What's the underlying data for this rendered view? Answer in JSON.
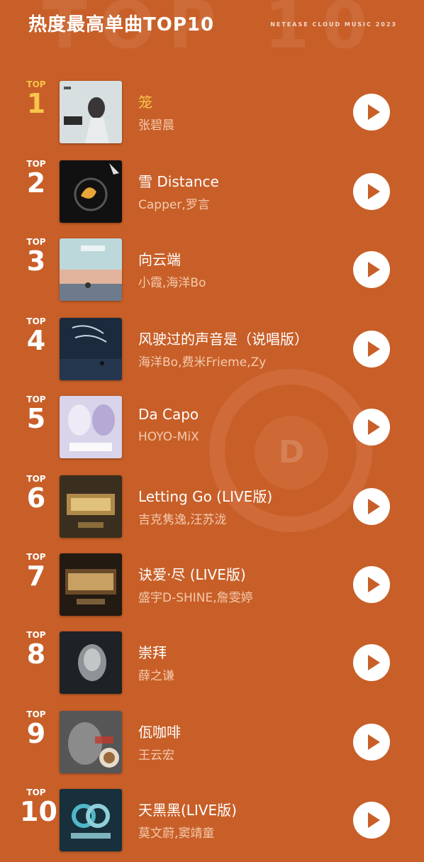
{
  "header": {
    "title": "热度最高单曲TOP10",
    "brand": "NETEASE CLOUD MUSIC 2023",
    "watermark": "TOP 10"
  },
  "rank_prefix": "TOP",
  "colors": {
    "background": "#c85f28",
    "highlight": "#f6c54a"
  },
  "songs": [
    {
      "rank": "1",
      "title": "笼",
      "artist": "张碧晨",
      "highlight": true
    },
    {
      "rank": "2",
      "title": "雪 Distance",
      "artist": "Capper,罗言",
      "highlight": false
    },
    {
      "rank": "3",
      "title": "向云端",
      "artist": "小霞,海洋Bo",
      "highlight": false
    },
    {
      "rank": "4",
      "title": "风驶过的声音是（说唱版）",
      "artist": "海洋Bo,费米Frieme,Zy",
      "highlight": false
    },
    {
      "rank": "5",
      "title": "Da Capo",
      "artist": "HOYO-MiX",
      "highlight": false
    },
    {
      "rank": "6",
      "title": "Letting Go (LIVE版)",
      "artist": "吉克隽逸,汪苏泷",
      "highlight": false
    },
    {
      "rank": "7",
      "title": "诀爱·尽 (LIVE版)",
      "artist": "盛宇D-SHINE,詹雯婷",
      "highlight": false
    },
    {
      "rank": "8",
      "title": "崇拜",
      "artist": "薛之谦",
      "highlight": false
    },
    {
      "rank": "9",
      "title": "佤咖啡",
      "artist": "王云宏",
      "highlight": false
    },
    {
      "rank": "10",
      "title": "天黑黑(LIVE版)",
      "artist": "莫文蔚,窦靖童",
      "highlight": false
    }
  ]
}
